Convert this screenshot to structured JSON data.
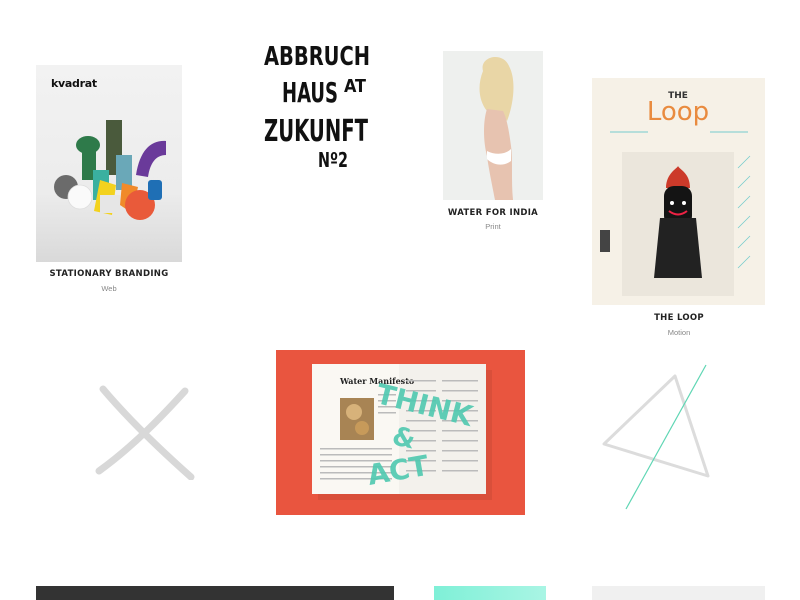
{
  "projects": [
    {
      "title": "STATIONARY BRANDING",
      "category": "Web"
    },
    {
      "title": "WATER FOR INDIA",
      "category": "Print"
    },
    {
      "title": "THE LOOP",
      "category": "Motion"
    }
  ],
  "kvadrat": {
    "logo": "kvadrat"
  },
  "abbruch": {
    "line1": "ABBRUCH",
    "line2": "HAUS",
    "line2b": "AT",
    "line3": "ZUKUNFT",
    "line4": "Nº2"
  },
  "loop_cover": {
    "the": "THE",
    "loop": "Loop"
  },
  "magazine": {
    "left_title": "Water Manifesto",
    "overlay1": "THINK",
    "overlay2": "&",
    "overlay3": "ACT"
  },
  "colors": {
    "accent_red": "#e9553f",
    "mint": "#5fd6b4",
    "dark": "#333333",
    "light_gray": "#f0f0f0"
  },
  "icons": [
    "x-mark-icon",
    "triangle-icon"
  ]
}
